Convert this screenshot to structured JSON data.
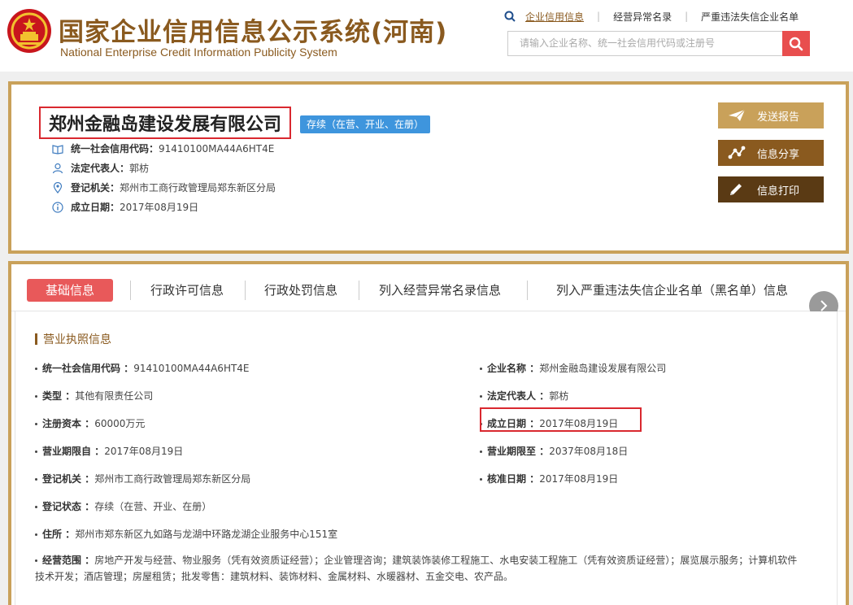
{
  "header": {
    "title": "国家企业信用信息公示系统(河南)",
    "subtitle": "National Enterprise Credit Information Publicity System",
    "nav": [
      "企业信用信息",
      "经营异常名录",
      "严重违法失信企业名单"
    ],
    "search_placeholder": "请输入企业名称、统一社会信用代码或注册号",
    "accent": "#8a5a1f",
    "search_button_color": "#e84e4e"
  },
  "company": {
    "name": "郑州金融岛建设发展有限公司",
    "status": "存续（在营、开业、在册）",
    "credit_code_label": "统一社会信用代码：",
    "credit_code": "91410100MA44A6HT4E",
    "legal_rep_label": "法定代表人：",
    "legal_rep": "郭枋",
    "authority_label": "登记机关：",
    "authority": "郑州市工商行政管理局郑东新区分局",
    "founded_label": "成立日期：",
    "founded": "2017年08月19日"
  },
  "actions": {
    "send": "发送报告",
    "share": "信息分享",
    "print": "信息打印"
  },
  "tabs": [
    "基础信息",
    "行政许可信息",
    "行政处罚信息",
    "列入经营异常名录信息",
    "列入严重违法失信企业名单（黑名单）信息"
  ],
  "detail": {
    "section_title": "营业执照信息",
    "fields": {
      "credit_code_k": "统一社会信用代码 ：",
      "credit_code_v": "91410100MA44A6HT4E",
      "name_k": "企业名称 ：",
      "name_v": "郑州金融岛建设发展有限公司",
      "type_k": "类型 ：",
      "type_v": "其他有限责任公司",
      "legal_k": "法定代表人 ：",
      "legal_v": "郭枋",
      "capital_k": "注册资本 ：",
      "capital_v": "60000万元",
      "founded_k": "成立日期 ：",
      "founded_v": "2017年08月19日",
      "term_from_k": "营业期限自 ：",
      "term_from_v": "2017年08月19日",
      "term_to_k": "营业期限至 ：",
      "term_to_v": "2037年08月18日",
      "authority_k": "登记机关 ：",
      "authority_v": "郑州市工商行政管理局郑东新区分局",
      "approve_k": "核准日期 ：",
      "approve_v": "2017年08月19日",
      "reg_status_k": "登记状态 ：",
      "reg_status_v": "存续（在营、开业、在册）",
      "address_k": "住所 ：",
      "address_v": "郑州市郑东新区九如路与龙湖中环路龙湖企业服务中心151室",
      "scope_k": "经营范围 ：",
      "scope_v": "房地产开发与经营、物业服务（凭有效资质证经营）；企业管理咨询；建筑装饰装修工程施工、水电安装工程施工（凭有效资质证经营）；展览展示服务；计算机软件技术开发；酒店管理；房屋租赁；批发零售：建筑材料、装饰材料、金属材料、水暖器材、五金交电、农产品。"
    }
  }
}
